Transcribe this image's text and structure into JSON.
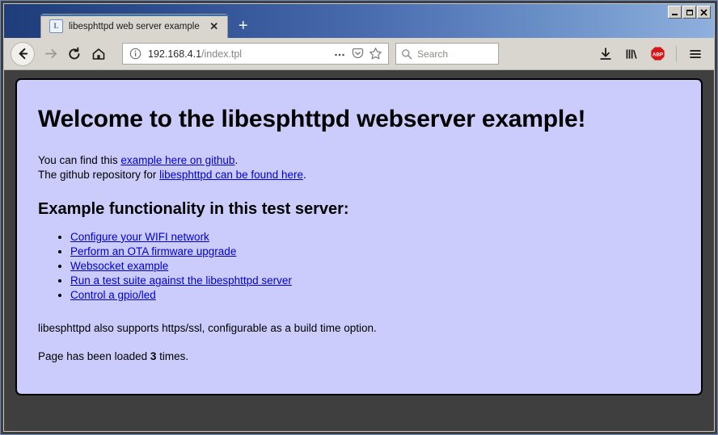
{
  "window": {
    "controls": {
      "minimize": "_",
      "maximize": "□",
      "close": "✕"
    }
  },
  "browser": {
    "tab": {
      "favicon": "favicon-libesphttpd",
      "title": "libesphttpd web server example",
      "close_label": "✕"
    },
    "new_tab_label": "+",
    "nav": {
      "back": "back-arrow-icon",
      "forward": "forward-arrow-icon",
      "reload": "reload-icon",
      "home": "home-icon"
    },
    "urlbar": {
      "identity_icon": "info-circle-icon",
      "url_host": "192.168.4.1",
      "url_path": "/index.tpl",
      "page_actions_icon": "ellipsis-icon",
      "pocket_icon": "pocket-icon",
      "bookmark_icon": "star-icon"
    },
    "search": {
      "icon": "search-icon",
      "placeholder": "Search"
    },
    "toolbar_right": {
      "downloads_icon": "download-arrow-icon",
      "library_icon": "library-bars-icon",
      "adblock_label": "ABP",
      "adblock_icon": "adblock-plus-icon",
      "menu_icon": "hamburger-menu-icon"
    }
  },
  "page": {
    "heading": "Welcome to the libesphttpd webserver example!",
    "intro": {
      "line1_prefix": "You can find this ",
      "line1_link": "example here on github",
      "line1_suffix": ".",
      "line2_prefix": "The github repository for ",
      "line2_link": "libesphttpd can be found here",
      "line2_suffix": "."
    },
    "section_heading": "Example functionality in this test server:",
    "links": [
      "Configure your WIFI network",
      "Perform an OTA firmware upgrade",
      "Websocket example",
      "Run a test suite against the libesphttpd server",
      "Control a gpio/led"
    ],
    "ssl_note": "libesphttpd also supports https/ssl, configurable as a build time option.",
    "counter": {
      "prefix": "Page has been loaded ",
      "value": "3",
      "suffix": " times."
    }
  },
  "colors": {
    "page_background": "#ccccfc",
    "link": "#0000cc",
    "titlebar_left": "#1f3d7a",
    "titlebar_right": "#8fb0dd",
    "adblock_red": "#d3171a"
  }
}
